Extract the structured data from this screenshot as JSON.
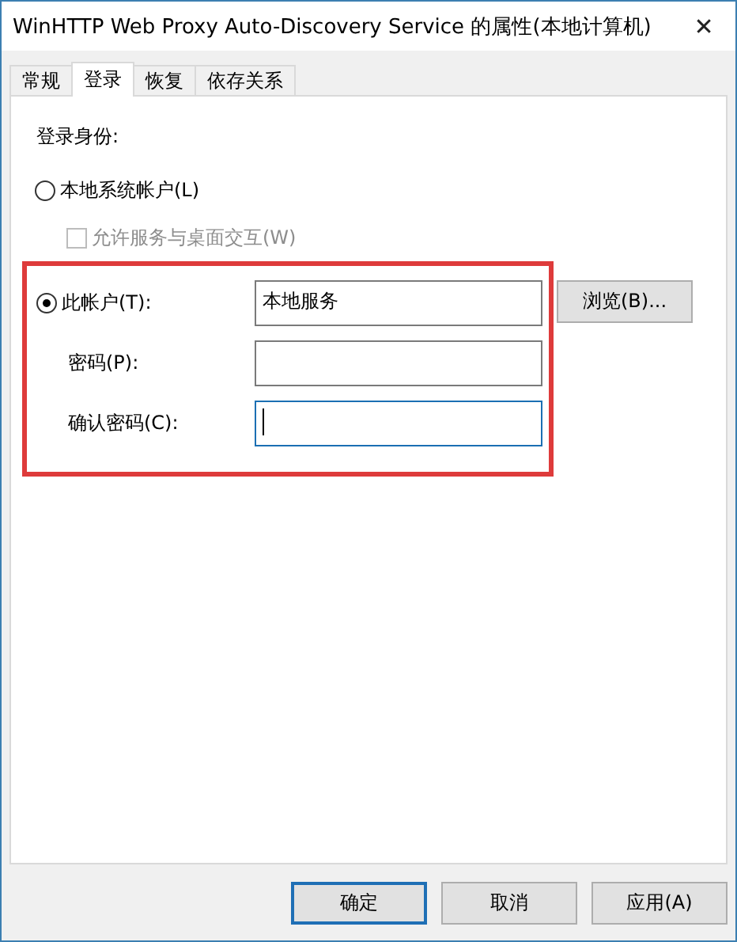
{
  "window": {
    "title": "WinHTTP Web Proxy Auto-Discovery Service 的属性(本地计算机)",
    "close": "✕"
  },
  "tabs": [
    {
      "label": "常规",
      "selected": false
    },
    {
      "label": "登录",
      "selected": true
    },
    {
      "label": "恢复",
      "selected": false
    },
    {
      "label": "依存关系",
      "selected": false
    }
  ],
  "logon": {
    "heading": "登录身份:",
    "local_system": {
      "label": "本地系统帐户(L)",
      "selected": false
    },
    "interact": {
      "label": "允许服务与桌面交互(W)",
      "checked": false,
      "disabled": true
    },
    "this_account": {
      "label": "此帐户(T):",
      "selected": true
    },
    "account_field": {
      "value": "本地服务",
      "focused": false
    },
    "browse_button": "浏览(B)...",
    "password": {
      "label": "密码(P):",
      "focused": false
    },
    "confirm": {
      "label": "确认密码(C):",
      "focused": true
    }
  },
  "buttons": [
    {
      "label": "确定",
      "default": true
    },
    {
      "label": "取消",
      "default": false
    },
    {
      "label": "应用(A)",
      "default": false
    }
  ]
}
